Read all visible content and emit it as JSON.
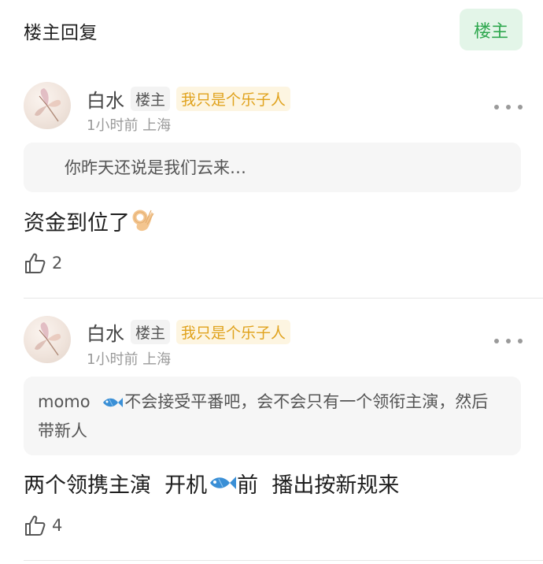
{
  "header": {
    "title": "楼主回复",
    "filter_button": "楼主"
  },
  "posts": [
    {
      "user_name": "白水",
      "op_badge": "楼主",
      "title_badge": "我只是个乐子人",
      "meta": "1小时前 上海",
      "quote": "你昨天还说是我们云来…",
      "reply": "资金到位了",
      "reply_emoji": "ok-hand-emoji",
      "likes": "2"
    },
    {
      "user_name": "白水",
      "op_badge": "楼主",
      "title_badge": "我只是个乐子人",
      "meta": "1小时前 上海",
      "quote_user": "momo",
      "quote_rest": "不会接受平番吧，会不会只有一个领衔主演，然后带新人",
      "reply_part1": "两个领携主演  开机",
      "reply_part2": "前  播出按新规来",
      "reply_emoji": "fish-icon",
      "likes": "4"
    }
  ],
  "colors": {
    "accent_green": "#2fa84f",
    "badge_gold": "#e0a21c",
    "meta_gray": "#9a9a9a",
    "fish_blue": "#3a8fd6"
  }
}
